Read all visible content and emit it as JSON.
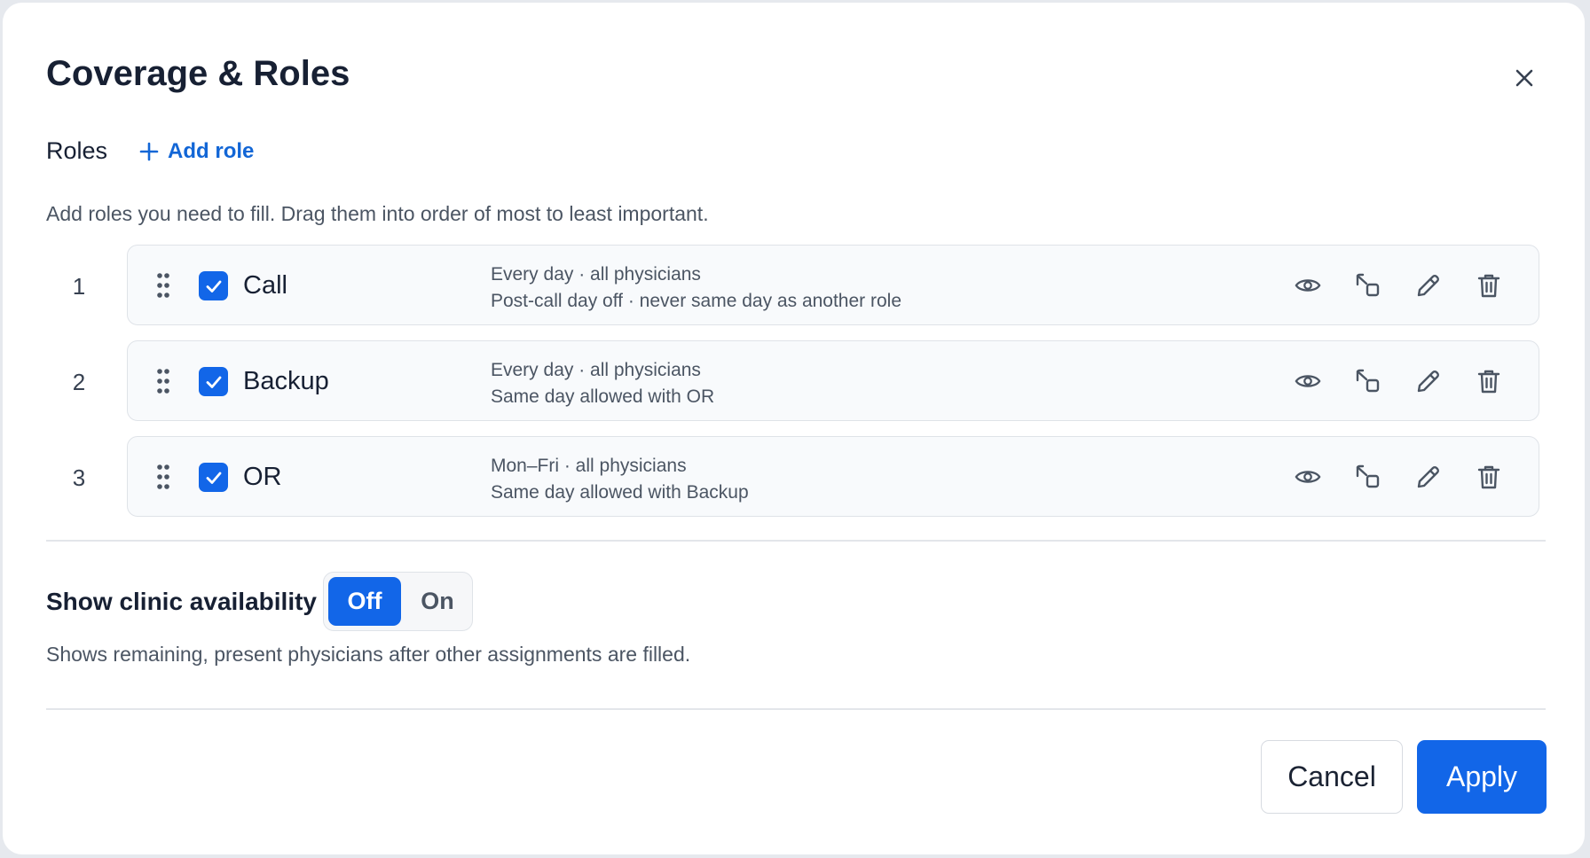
{
  "dialog": {
    "title": "Coverage & Roles"
  },
  "roles_section": {
    "label": "Roles",
    "add_role_label": "Add role",
    "hint": "Add roles you need to fill. Drag them into order of most to least important."
  },
  "roles": [
    {
      "number": "1",
      "name": "Call",
      "checked": true,
      "line1": "Every day · all physicians",
      "line2": "Post-call day off · never same day as another role"
    },
    {
      "number": "2",
      "name": "Backup",
      "checked": true,
      "line1": "Every day · all physicians",
      "line2": "Same day allowed with OR"
    },
    {
      "number": "3",
      "name": "OR",
      "checked": true,
      "line1": "Mon–Fri · all physicians",
      "line2": "Same day allowed with Backup"
    }
  ],
  "role_actions": [
    "eye-icon",
    "copy-icon",
    "pencil-icon",
    "trash-icon"
  ],
  "clinic": {
    "label": "Show clinic availability",
    "toggle_off": "Off",
    "toggle_on": "On",
    "selected": "Off",
    "hint": "Shows remaining, present physicians after other assignments are filled."
  },
  "footer": {
    "cancel_label": "Cancel",
    "apply_label": "Apply"
  },
  "colors": {
    "accent": "#1266e8",
    "link": "#1266d6",
    "card_bg": "#f8fafc",
    "border": "#dfe3e8"
  }
}
